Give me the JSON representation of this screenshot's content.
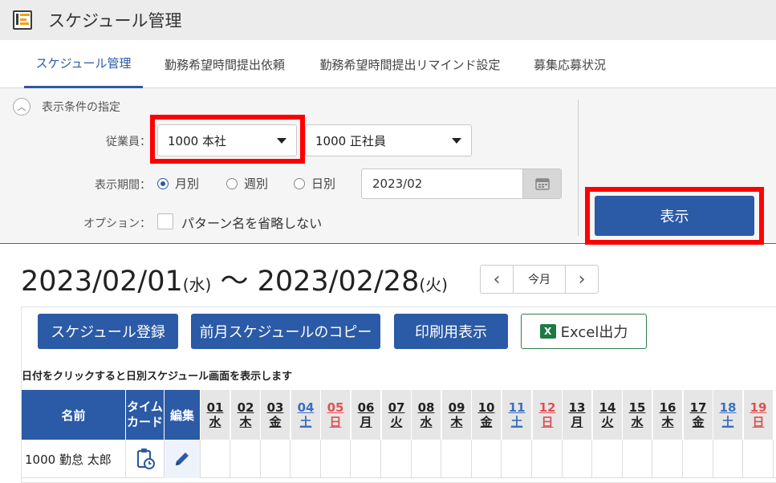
{
  "app": {
    "title": "スケジュール管理",
    "icon": "schedule-app-icon"
  },
  "tabs": [
    {
      "label": "スケジュール管理",
      "active": true
    },
    {
      "label": "勤務希望時間提出依頼",
      "active": false
    },
    {
      "label": "勤務希望時間提出リマインド設定",
      "active": false
    },
    {
      "label": "募集応募状況",
      "active": false
    }
  ],
  "conditions": {
    "title": "表示条件の指定",
    "employee_label": "従業員：",
    "employee_select_1": "1000 本社",
    "employee_select_2": "1000 正社員",
    "period_label": "表示期間：",
    "period_options": [
      "月別",
      "週別",
      "日別"
    ],
    "period_selected": "月別",
    "date_value": "2023/02",
    "option_label": "オプション：",
    "option_checkbox_label": "パターン名を省略しない",
    "option_checked": false,
    "show_button": "表示"
  },
  "range": {
    "start": "2023/02/01",
    "start_dow": "(水)",
    "separator": " 〜 ",
    "end": "2023/02/28",
    "end_dow": "(火)",
    "today_label": "今月"
  },
  "actions": {
    "register": "スケジュール登録",
    "copy_prev": "前月スケジュールのコピー",
    "print": "印刷用表示",
    "excel": "Excel出力"
  },
  "hint": "日付をクリックすると日別スケジュール画面を表示します",
  "table": {
    "headers": {
      "name": "名前",
      "timecard_1": "タイム",
      "timecard_2": "カード",
      "edit": "編集"
    },
    "days": [
      {
        "d": "01",
        "w": "水",
        "color": "#222222"
      },
      {
        "d": "02",
        "w": "木",
        "color": "#222222"
      },
      {
        "d": "03",
        "w": "金",
        "color": "#222222"
      },
      {
        "d": "04",
        "w": "土",
        "color": "#3b6fbf"
      },
      {
        "d": "05",
        "w": "日",
        "color": "#e05050"
      },
      {
        "d": "06",
        "w": "月",
        "color": "#222222"
      },
      {
        "d": "07",
        "w": "火",
        "color": "#222222"
      },
      {
        "d": "08",
        "w": "水",
        "color": "#222222"
      },
      {
        "d": "09",
        "w": "木",
        "color": "#222222"
      },
      {
        "d": "10",
        "w": "金",
        "color": "#222222"
      },
      {
        "d": "11",
        "w": "土",
        "color": "#3b6fbf"
      },
      {
        "d": "12",
        "w": "日",
        "color": "#e05050"
      },
      {
        "d": "13",
        "w": "月",
        "color": "#222222"
      },
      {
        "d": "14",
        "w": "火",
        "color": "#222222"
      },
      {
        "d": "15",
        "w": "水",
        "color": "#222222"
      },
      {
        "d": "16",
        "w": "木",
        "color": "#222222"
      },
      {
        "d": "17",
        "w": "金",
        "color": "#222222"
      },
      {
        "d": "18",
        "w": "土",
        "color": "#3b6fbf"
      },
      {
        "d": "19",
        "w": "日",
        "color": "#e05050"
      }
    ],
    "rows": [
      {
        "name": "1000 勤怠 太郎"
      }
    ]
  },
  "colors": {
    "accent": "#2b5aa6",
    "highlight": "#ff0000",
    "excel_green": "#1d7a45"
  }
}
